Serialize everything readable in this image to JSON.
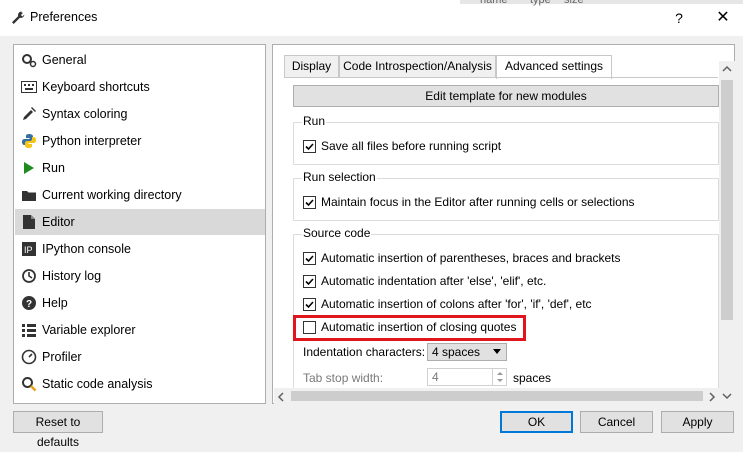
{
  "window": {
    "title": "Preferences",
    "help_label": "?",
    "close_label": "✕",
    "background_strip": [
      "name",
      "type",
      "size"
    ]
  },
  "sidebar": {
    "items": [
      {
        "label": "General",
        "icon": "gears-icon"
      },
      {
        "label": "Keyboard shortcuts",
        "icon": "keyboard-icon"
      },
      {
        "label": "Syntax coloring",
        "icon": "eyedropper-icon"
      },
      {
        "label": "Python interpreter",
        "icon": "python-icon"
      },
      {
        "label": "Run",
        "icon": "play-icon"
      },
      {
        "label": "Current working directory",
        "icon": "folder-icon"
      },
      {
        "label": "Editor",
        "icon": "editor-icon",
        "selected": true
      },
      {
        "label": "IPython console",
        "icon": "ipython-icon"
      },
      {
        "label": "History log",
        "icon": "history-icon"
      },
      {
        "label": "Help",
        "icon": "help-icon"
      },
      {
        "label": "Variable explorer",
        "icon": "grid-icon"
      },
      {
        "label": "Profiler",
        "icon": "profiler-icon"
      },
      {
        "label": "Static code analysis",
        "icon": "analysis-icon"
      }
    ]
  },
  "tabs": [
    {
      "label": "Display",
      "active": false
    },
    {
      "label": "Code Introspection/Analysis",
      "active": false
    },
    {
      "label": "Advanced settings",
      "active": true
    }
  ],
  "edit_template_label": "Edit template for new modules",
  "groups": {
    "run": {
      "title": "Run",
      "options": [
        {
          "label": "Save all files before running script",
          "checked": true
        }
      ]
    },
    "run_selection": {
      "title": "Run selection",
      "options": [
        {
          "label": "Maintain focus in the Editor after running cells or selections",
          "checked": true
        }
      ]
    },
    "source_code": {
      "title": "Source code",
      "options": [
        {
          "label": "Automatic insertion of parentheses, braces and brackets",
          "checked": true
        },
        {
          "label": "Automatic indentation after 'else', 'elif', etc.",
          "checked": true
        },
        {
          "label": "Automatic insertion of colons after 'for', 'if', 'def', etc",
          "checked": true
        },
        {
          "label": "Automatic insertion of closing quotes",
          "checked": false,
          "highlighted": true
        }
      ],
      "indentation_label": "Indentation characters:",
      "indentation_value": "4 spaces",
      "tab_stop_label": "Tab stop width:",
      "tab_stop_value": "4",
      "tab_stop_unit": "spaces"
    }
  },
  "footer": {
    "reset_label": "Reset to defaults",
    "ok_label": "OK",
    "cancel_label": "Cancel",
    "apply_label": "Apply"
  },
  "colors": {
    "highlight": "#e0161c",
    "focus": "#0078d7",
    "selected_item": "#d9d9d9"
  }
}
